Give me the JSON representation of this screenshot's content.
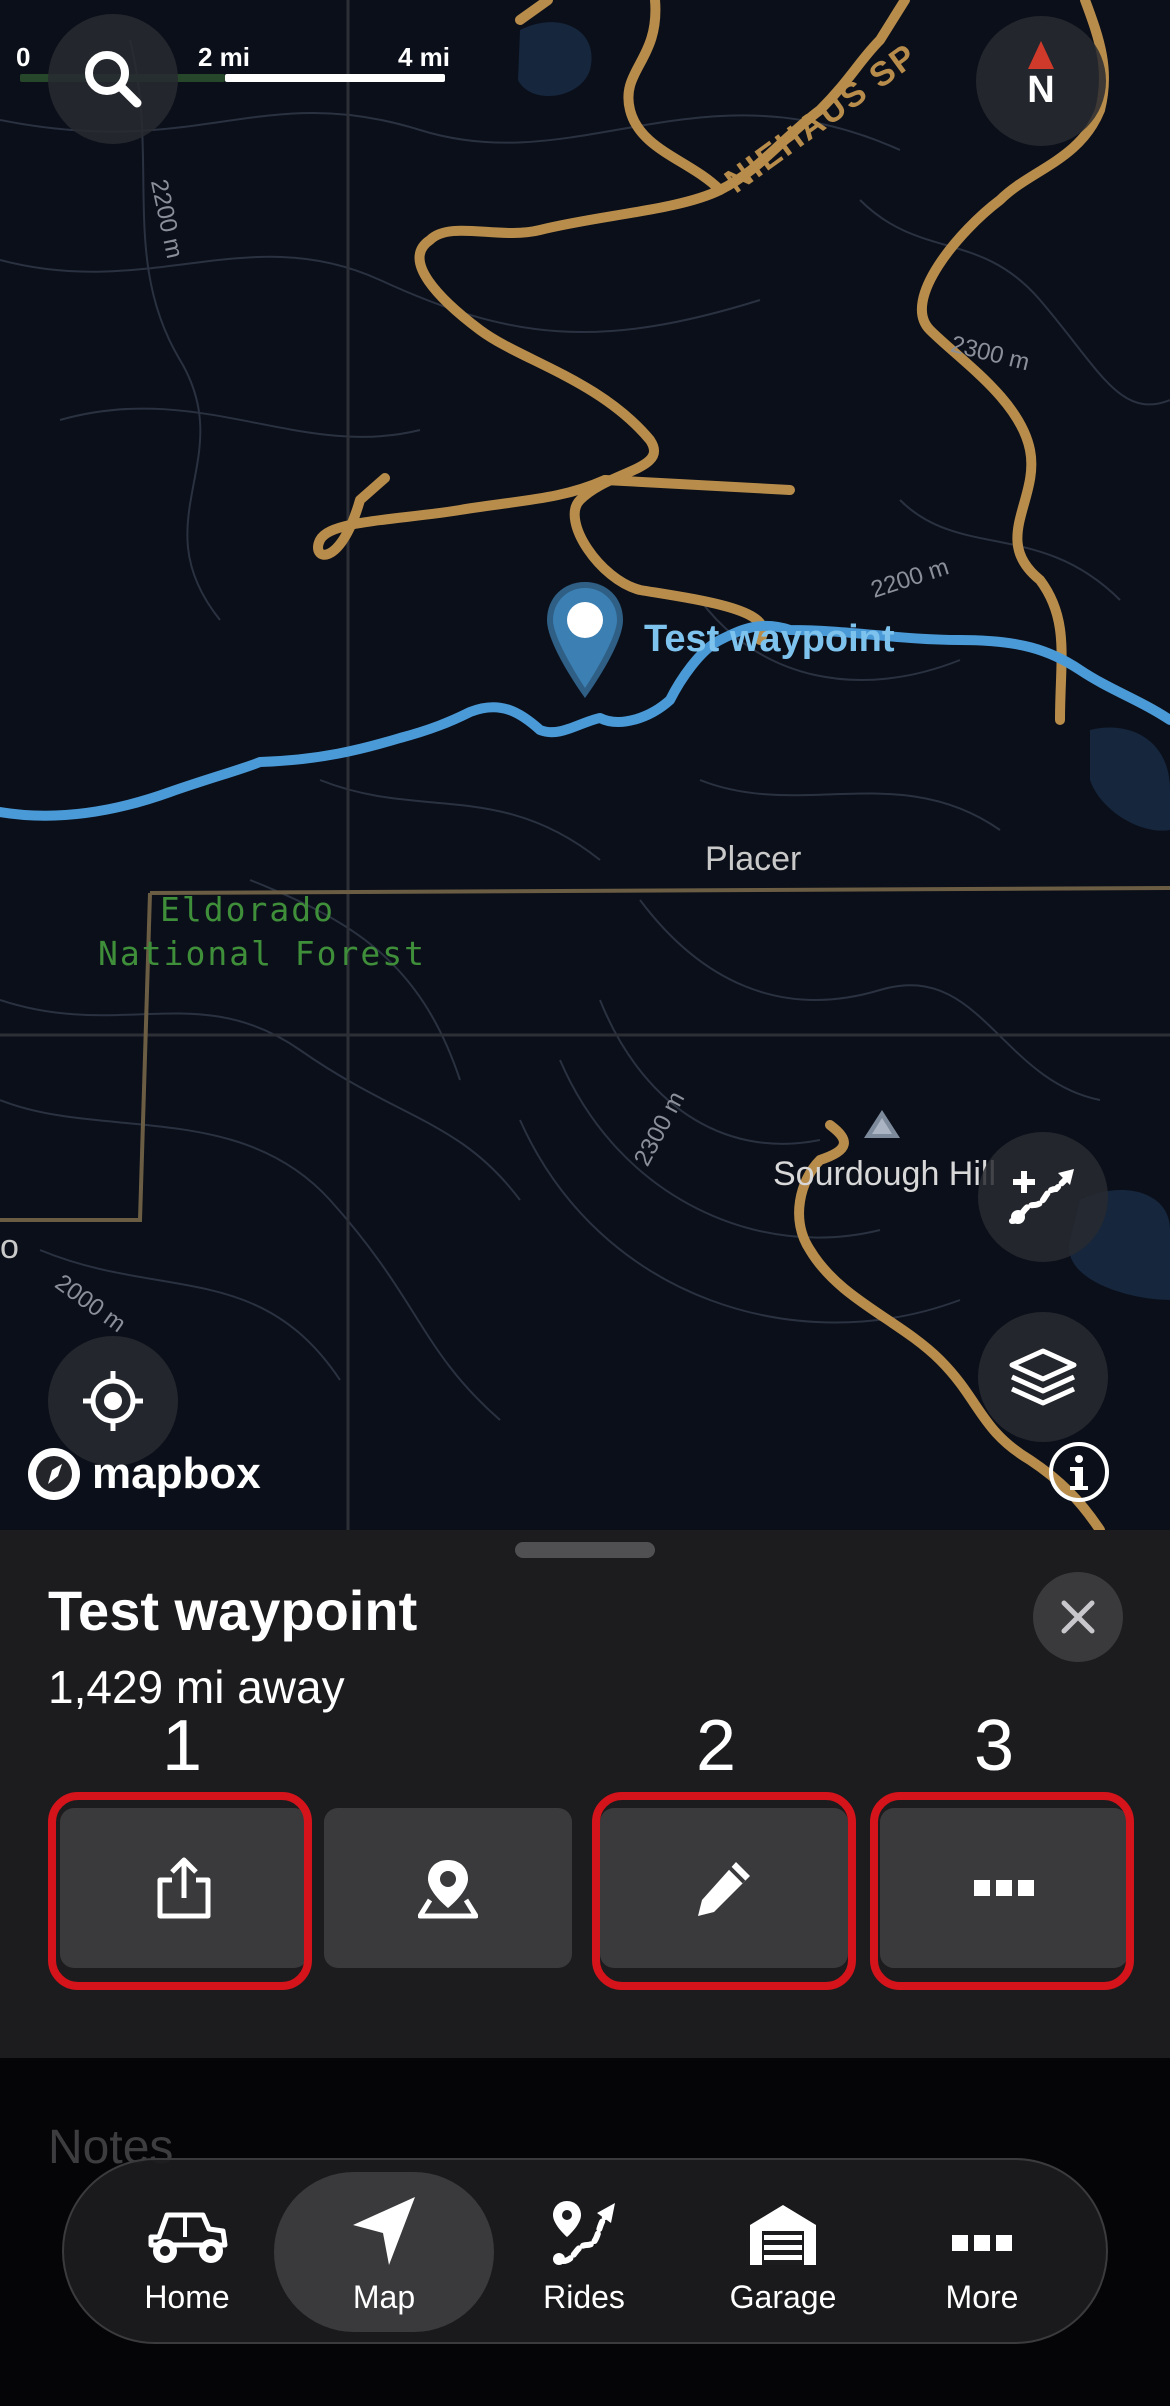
{
  "map": {
    "scale": {
      "start": "0",
      "mid": "2 mi",
      "end": "4 mi"
    },
    "compass": "N",
    "road_label": "NIEHAUS SP",
    "contours": [
      "2200 m",
      "2300 m",
      "2200 m",
      "2300 m",
      "2000 m"
    ],
    "waypoint_label": "Test waypoint",
    "place_label": "Placer",
    "forest_label_line1": "Eldorado",
    "forest_label_line2": "National Forest",
    "peak_label": "Sourdough Hill",
    "edge_label": "o",
    "attribution": "mapbox",
    "colors": {
      "road": "#b88d4c",
      "route": "#4a9ad8",
      "forest_text": "#3f8f3a",
      "background": "#0b0f19"
    }
  },
  "sheet": {
    "title": "Test waypoint",
    "subtitle": "1,429 mi away",
    "actions": [
      {
        "icon": "share-icon",
        "highlight": "1"
      },
      {
        "icon": "navigate-pin-icon",
        "highlight": ""
      },
      {
        "icon": "pencil-icon",
        "highlight": "2"
      },
      {
        "icon": "ellipsis-icon",
        "highlight": "3"
      }
    ],
    "highlight_color": "#d4141a"
  },
  "notes": {
    "label": "Notes"
  },
  "tabs": [
    {
      "label": "Home",
      "icon": "utv-icon",
      "active": false
    },
    {
      "label": "Map",
      "icon": "navigation-arrow-icon",
      "active": true
    },
    {
      "label": "Rides",
      "icon": "route-icon",
      "active": false
    },
    {
      "label": "Garage",
      "icon": "garage-icon",
      "active": false
    },
    {
      "label": "More",
      "icon": "ellipsis-icon",
      "active": false
    }
  ]
}
